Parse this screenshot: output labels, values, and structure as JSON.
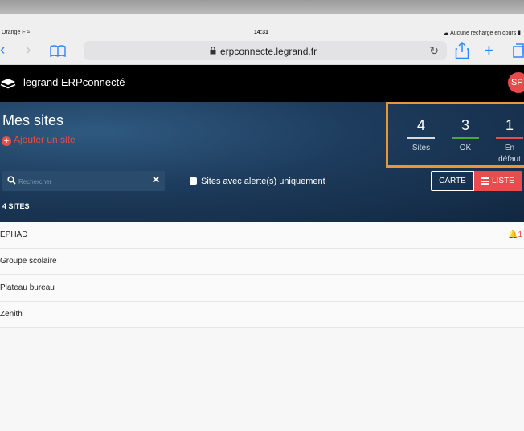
{
  "status_bar": {
    "carrier": "Orange F",
    "time": "14:31",
    "battery": "Aucune recharge en cours"
  },
  "browser": {
    "url": "erpconnecte.legrand.fr"
  },
  "app": {
    "title": "legrand ERPconnecté",
    "avatar_initials": "SP"
  },
  "page": {
    "title": "Mes sites",
    "add_site_label": "Ajouter un site",
    "stats": [
      {
        "value": "4",
        "label": "Sites",
        "color": "#d9d9d9"
      },
      {
        "value": "3",
        "label": "OK",
        "color": "#49a83d"
      },
      {
        "value": "1",
        "label": "En défaut",
        "color": "#e84c4c"
      }
    ],
    "search": {
      "placeholder": "Rechercher"
    },
    "filter_label": "Sites avec alerte(s) uniquement",
    "view_toggle": {
      "carte": "CARTE",
      "liste": "LISTE"
    },
    "site_count": "4 SITES"
  },
  "sites": [
    {
      "name": "EPHAD",
      "alerts": "1"
    },
    {
      "name": "Groupe scolaire",
      "alerts": ""
    },
    {
      "name": "Plateau bureau",
      "alerts": ""
    },
    {
      "name": "Zenith",
      "alerts": ""
    }
  ],
  "colors": {
    "accent": "#e84c4c",
    "highlight_box": "#e8963a",
    "appbar": "#000000",
    "hero": "#1d3b5c"
  }
}
